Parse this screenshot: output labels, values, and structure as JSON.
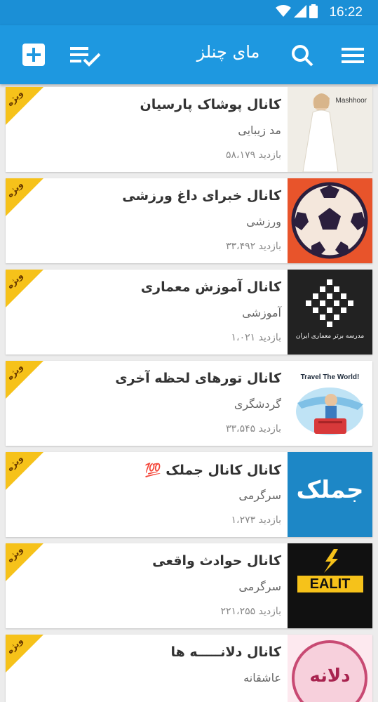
{
  "status_bar": {
    "time": "16:22"
  },
  "app_bar": {
    "title": "مای چنلز"
  },
  "ribbon_label": "ویژه",
  "channels": [
    {
      "title": "کانال پوشاک پارسیان",
      "category": "مد زیبایی",
      "views": "۵۸،۱۷۹",
      "views_label": "بازدید",
      "thumb_label": "Mashhoor",
      "thumb_color": "#f0ede6"
    },
    {
      "title": "کانال خبرای داغ ورزشی",
      "category": "ورزشی",
      "views": "۳۳،۴۹۲",
      "views_label": "بازدید",
      "thumb_label": "",
      "thumb_color": "#e8542b"
    },
    {
      "title": "کانال آموزش معماری",
      "category": "آموزشی",
      "views": "۱،۰۲۱",
      "views_label": "بازدید",
      "thumb_label": "مدرسه برتر معماری ایران",
      "thumb_color": "#222222"
    },
    {
      "title": "کانال تورهای لحظه آخری",
      "category": "گردشگری",
      "views": "۳۳،۵۴۵",
      "views_label": "بازدید",
      "thumb_label": "Travel The World!",
      "thumb_color": "#ffffff"
    },
    {
      "title": "کانال کانال جملک 💯",
      "category": "سرگرمی",
      "views": "۱،۲۷۳",
      "views_label": "بازدید",
      "thumb_label": "جملک",
      "thumb_color": "#1d87c6"
    },
    {
      "title": "کانال حوادث واقعی",
      "category": "سرگرمی",
      "views": "۲۲۱،۲۵۵",
      "views_label": "بازدید",
      "thumb_label": "EALIT",
      "thumb_color": "#111111"
    },
    {
      "title": "کانال دلانـــــه ها",
      "category": "عاشقانه",
      "views": "",
      "views_label": "",
      "thumb_label": "دلانه",
      "thumb_color": "#f7d0dc"
    }
  ]
}
